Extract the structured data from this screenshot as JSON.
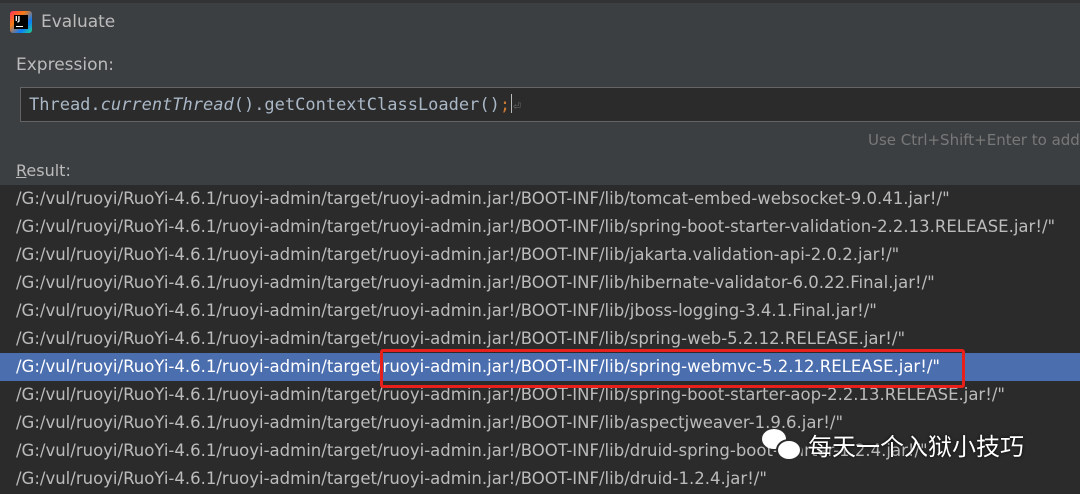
{
  "window": {
    "title": "Evaluate"
  },
  "expression": {
    "label": "Expression:",
    "code_part1": "Thread.",
    "code_italic": "currentThread",
    "code_part2": "().getContextClassLoader()",
    "code_semicolon": ";",
    "enter_mark": "⏎",
    "hint": "Use Ctrl+Shift+Enter to add t"
  },
  "result": {
    "label_mnemonic": "R",
    "label_rest": "esult:",
    "rows": [
      "/G:/vul/ruoyi/RuoYi-4.6.1/ruoyi-admin/target/ruoyi-admin.jar!/BOOT-INF/lib/tomcat-embed-websocket-9.0.41.jar!/\"",
      "/G:/vul/ruoyi/RuoYi-4.6.1/ruoyi-admin/target/ruoyi-admin.jar!/BOOT-INF/lib/spring-boot-starter-validation-2.2.13.RELEASE.jar!/\"",
      "/G:/vul/ruoyi/RuoYi-4.6.1/ruoyi-admin/target/ruoyi-admin.jar!/BOOT-INF/lib/jakarta.validation-api-2.0.2.jar!/\"",
      "/G:/vul/ruoyi/RuoYi-4.6.1/ruoyi-admin/target/ruoyi-admin.jar!/BOOT-INF/lib/hibernate-validator-6.0.22.Final.jar!/\"",
      "/G:/vul/ruoyi/RuoYi-4.6.1/ruoyi-admin/target/ruoyi-admin.jar!/BOOT-INF/lib/jboss-logging-3.4.1.Final.jar!/\"",
      "/G:/vul/ruoyi/RuoYi-4.6.1/ruoyi-admin/target/ruoyi-admin.jar!/BOOT-INF/lib/spring-web-5.2.12.RELEASE.jar!/\"",
      "/G:/vul/ruoyi/RuoYi-4.6.1/ruoyi-admin/target/ruoyi-admin.jar!/BOOT-INF/lib/spring-webmvc-5.2.12.RELEASE.jar!/\"",
      "/G:/vul/ruoyi/RuoYi-4.6.1/ruoyi-admin/target/ruoyi-admin.jar!/BOOT-INF/lib/spring-boot-starter-aop-2.2.13.RELEASE.jar!/\"",
      "/G:/vul/ruoyi/RuoYi-4.6.1/ruoyi-admin/target/ruoyi-admin.jar!/BOOT-INF/lib/aspectjweaver-1.9.6.jar!/\"",
      "/G:/vul/ruoyi/RuoYi-4.6.1/ruoyi-admin/target/ruoyi-admin.jar!/BOOT-INF/lib/druid-spring-boot-starter-1.2.4.jar!/\"",
      "/G:/vul/ruoyi/RuoYi-4.6.1/ruoyi-admin/target/ruoyi-admin.jar!/BOOT-INF/lib/druid-1.2.4.jar!/\""
    ],
    "selected_index": 6
  },
  "watermark": {
    "icon": "wechat-icon",
    "text": "每天一个入狱小技巧"
  },
  "colors": {
    "selection": "#4b6eaf",
    "highlight_box": "#e8201c"
  }
}
